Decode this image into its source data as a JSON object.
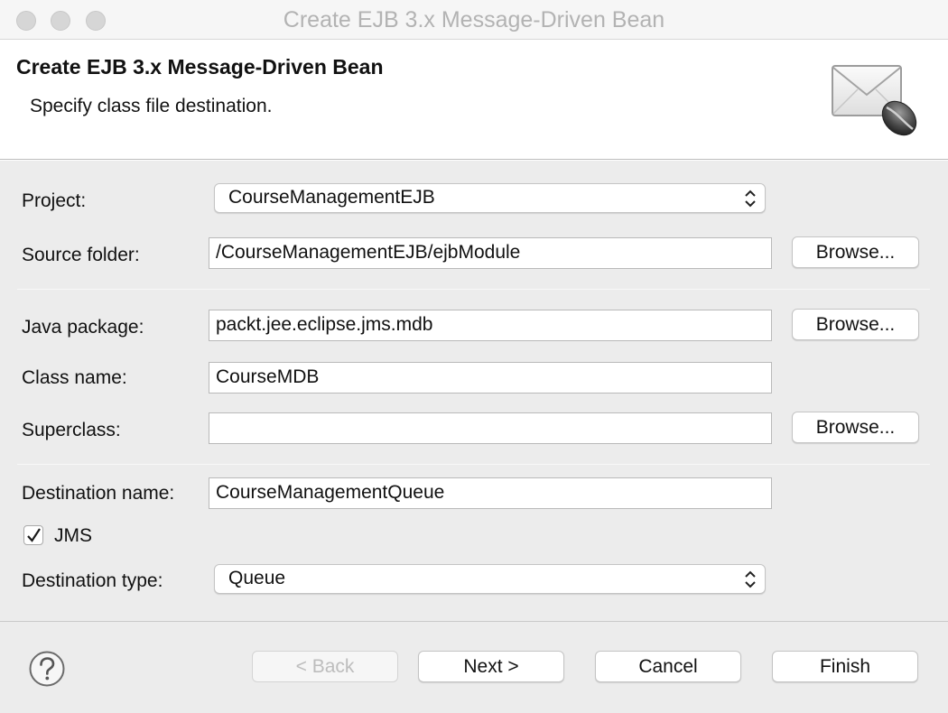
{
  "window": {
    "title": "Create EJB 3.x Message-Driven Bean"
  },
  "header": {
    "title": "Create EJB 3.x Message-Driven Bean",
    "description": "Specify class file destination.",
    "icon": "envelope-with-bean-icon"
  },
  "form": {
    "project": {
      "label": "Project:",
      "value": "CourseManagementEJB"
    },
    "source_folder": {
      "label": "Source folder:",
      "value": "/CourseManagementEJB/ejbModule",
      "browse_label": "Browse..."
    },
    "java_package": {
      "label": "Java package:",
      "value": "packt.jee.eclipse.jms.mdb",
      "browse_label": "Browse..."
    },
    "class_name": {
      "label": "Class name:",
      "value": "CourseMDB"
    },
    "superclass": {
      "label": "Superclass:",
      "value": "",
      "browse_label": "Browse..."
    },
    "destination_name": {
      "label": "Destination name:",
      "value": "CourseManagementQueue"
    },
    "jms": {
      "label": "JMS",
      "checked": true
    },
    "destination_type": {
      "label": "Destination type:",
      "value": "Queue"
    }
  },
  "footer": {
    "help_icon": "question-mark-icon",
    "back_label": "< Back",
    "next_label": "Next >",
    "cancel_label": "Cancel",
    "finish_label": "Finish"
  }
}
